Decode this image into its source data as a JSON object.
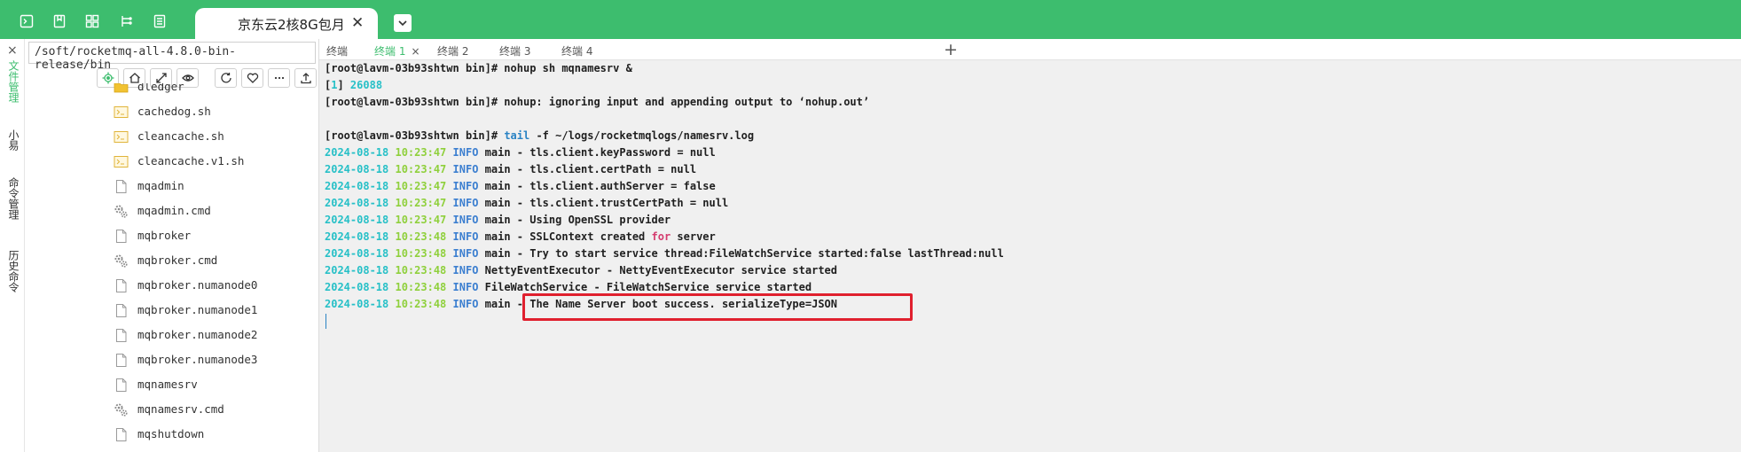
{
  "window": {
    "session_tab_title": "京东云2核8G包月",
    "session_tab_close": "✕"
  },
  "rail": {
    "items": [
      {
        "label": "文件管理",
        "active": true
      },
      {
        "label": "小易",
        "active": false
      },
      {
        "label": "命令管理",
        "active": false
      },
      {
        "label": "历史命令",
        "active": false
      }
    ]
  },
  "file_panel": {
    "close_glyph": "×",
    "path": "/soft/rocketmq-all-4.8.0-bin-release/bin",
    "files": [
      {
        "name": "dledger",
        "type": "folder"
      },
      {
        "name": "cachedog.sh",
        "type": "script"
      },
      {
        "name": "cleancache.sh",
        "type": "script"
      },
      {
        "name": "cleancache.v1.sh",
        "type": "script"
      },
      {
        "name": "mqadmin",
        "type": "file"
      },
      {
        "name": "mqadmin.cmd",
        "type": "cmd"
      },
      {
        "name": "mqbroker",
        "type": "file"
      },
      {
        "name": "mqbroker.cmd",
        "type": "cmd"
      },
      {
        "name": "mqbroker.numanode0",
        "type": "file"
      },
      {
        "name": "mqbroker.numanode1",
        "type": "file"
      },
      {
        "name": "mqbroker.numanode2",
        "type": "file"
      },
      {
        "name": "mqbroker.numanode3",
        "type": "file"
      },
      {
        "name": "mqnamesrv",
        "type": "file"
      },
      {
        "name": "mqnamesrv.cmd",
        "type": "cmd"
      },
      {
        "name": "mqshutdown",
        "type": "file"
      }
    ]
  },
  "terminal_tabs": {
    "tabs": [
      {
        "label": "终端",
        "active": false
      },
      {
        "label": "终端 1",
        "active": true,
        "close": "×"
      },
      {
        "label": "终端 2",
        "active": false
      },
      {
        "label": "终端 3",
        "active": false
      },
      {
        "label": "终端 4",
        "active": false
      }
    ],
    "add_glyph": "+"
  },
  "terminal": {
    "prompt": "[root@lavm-03b93shtwn bin]#",
    "l1_cmd": " nohup sh mqnamesrv &",
    "l2_job": "1",
    "l2_pid": "26088",
    "l3_text": " nohup: ignoring input and appending output to ‘nohup.out’",
    "l5_tail": "tail",
    "l5_rest": " -f ~/logs/rocketmqlogs/namesrv.log",
    "log_date": "2024-08-18",
    "log_level": "INFO",
    "log_lines": [
      {
        "time": "10:23:47",
        "msg": " main - tls.client.keyPassword = null"
      },
      {
        "time": "10:23:47",
        "msg": " main - tls.client.certPath = null"
      },
      {
        "time": "10:23:47",
        "msg": " main - tls.client.authServer = false"
      },
      {
        "time": "10:23:47",
        "msg": " main - tls.client.trustCertPath = null"
      },
      {
        "time": "10:23:47",
        "msg": " main - Using OpenSSL provider"
      },
      {
        "time": "10:23:48",
        "msg": " main - SSLContext created ",
        "kw": "for",
        "msg2": " server"
      },
      {
        "time": "10:23:48",
        "msg": " main - Try to start service thread:FileWatchService started:false lastThread:null"
      },
      {
        "time": "10:23:48",
        "msg": " NettyEventExecutor - NettyEventExecutor service started"
      },
      {
        "time": "10:23:48",
        "msg": " FileWatchService - FileWatchService service started"
      },
      {
        "time": "10:23:48",
        "msg": " main - The Name Server boot success. serializeType=JSON"
      }
    ]
  },
  "colors": {
    "accent": "#3dbd6e",
    "highlight_box": "#e0202e",
    "terminal_bg": "#f0f0f0"
  }
}
